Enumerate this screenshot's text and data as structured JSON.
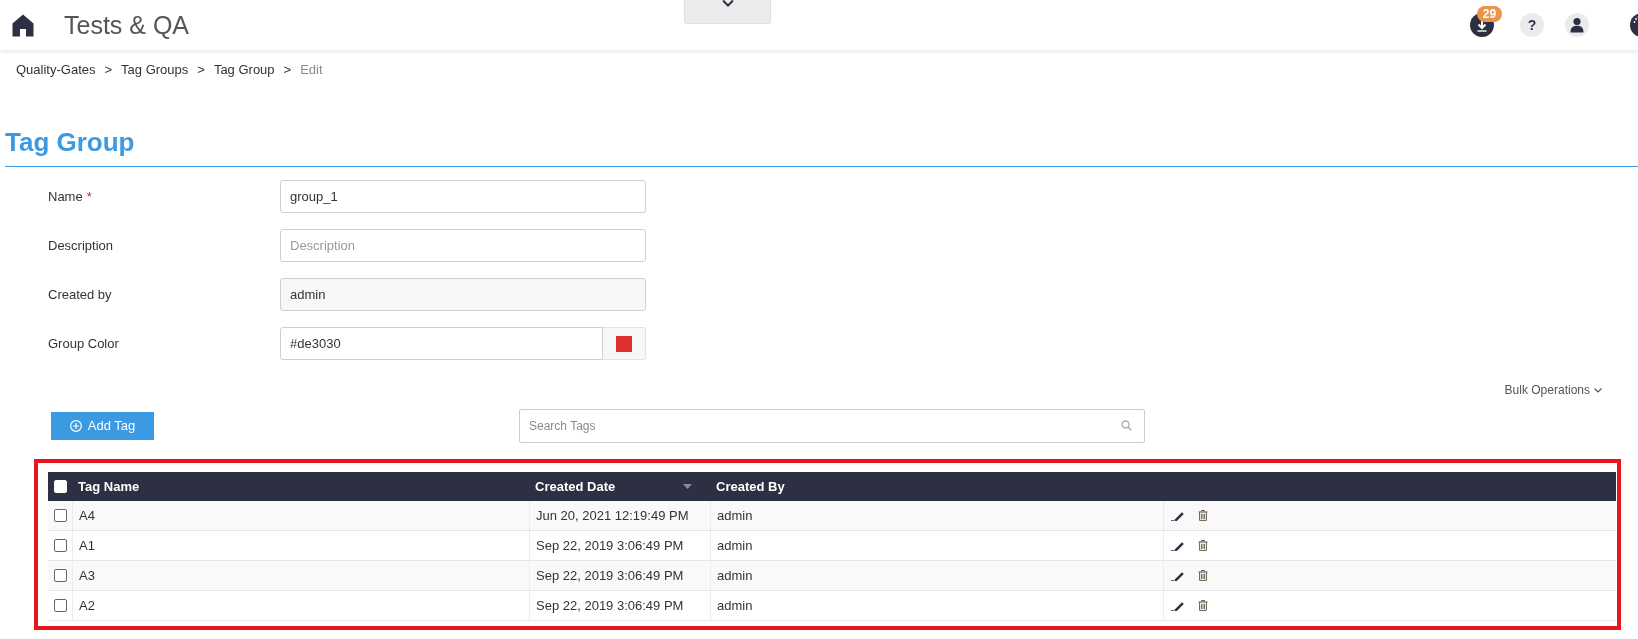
{
  "header": {
    "title": "Tests & QA",
    "notification_count": "29",
    "help_label": "?"
  },
  "breadcrumb": [
    {
      "kind": "link",
      "label": "Quality-Gates"
    },
    {
      "kind": "separator",
      "label": ">"
    },
    {
      "kind": "link",
      "label": "Tag Groups"
    },
    {
      "kind": "separator",
      "label": ">"
    },
    {
      "kind": "link",
      "label": "Tag Group"
    },
    {
      "kind": "separator",
      "label": ">"
    },
    {
      "kind": "current",
      "label": "Edit"
    }
  ],
  "page_title": "Tag Group",
  "form": {
    "fields": [
      {
        "kind": "text",
        "label": "Name",
        "required_mark": "*",
        "value": "group_1"
      },
      {
        "kind": "text",
        "label": "Description",
        "placeholder": "Description"
      },
      {
        "kind": "readonly",
        "label": "Created by",
        "value": "admin"
      },
      {
        "kind": "color",
        "label": "Group Color",
        "value": "#de3030",
        "color": "#de3030"
      }
    ]
  },
  "toolbar": {
    "bulk_operations": "Bulk Operations",
    "add_button": "Add Tag",
    "search": {
      "placeholder": "Search Tags"
    }
  },
  "table": {
    "select_all_checked": false,
    "columns": [
      {
        "label": "Tag Name",
        "sorted": false
      },
      {
        "label": "Created Date",
        "sorted": true
      },
      {
        "label": "Created By",
        "sorted": false
      }
    ],
    "rows": [
      {
        "checked": false,
        "cells": [
          "A4",
          "Jun 20, 2021 12:19:49 PM",
          "admin"
        ]
      },
      {
        "checked": false,
        "cells": [
          "A1",
          "Sep 22, 2019 3:06:49 PM",
          "admin"
        ]
      },
      {
        "checked": false,
        "cells": [
          "A3",
          "Sep 22, 2019 3:06:49 PM",
          "admin"
        ]
      },
      {
        "checked": false,
        "cells": [
          "A2",
          "Sep 22, 2019 3:06:49 PM",
          "admin"
        ]
      }
    ]
  }
}
